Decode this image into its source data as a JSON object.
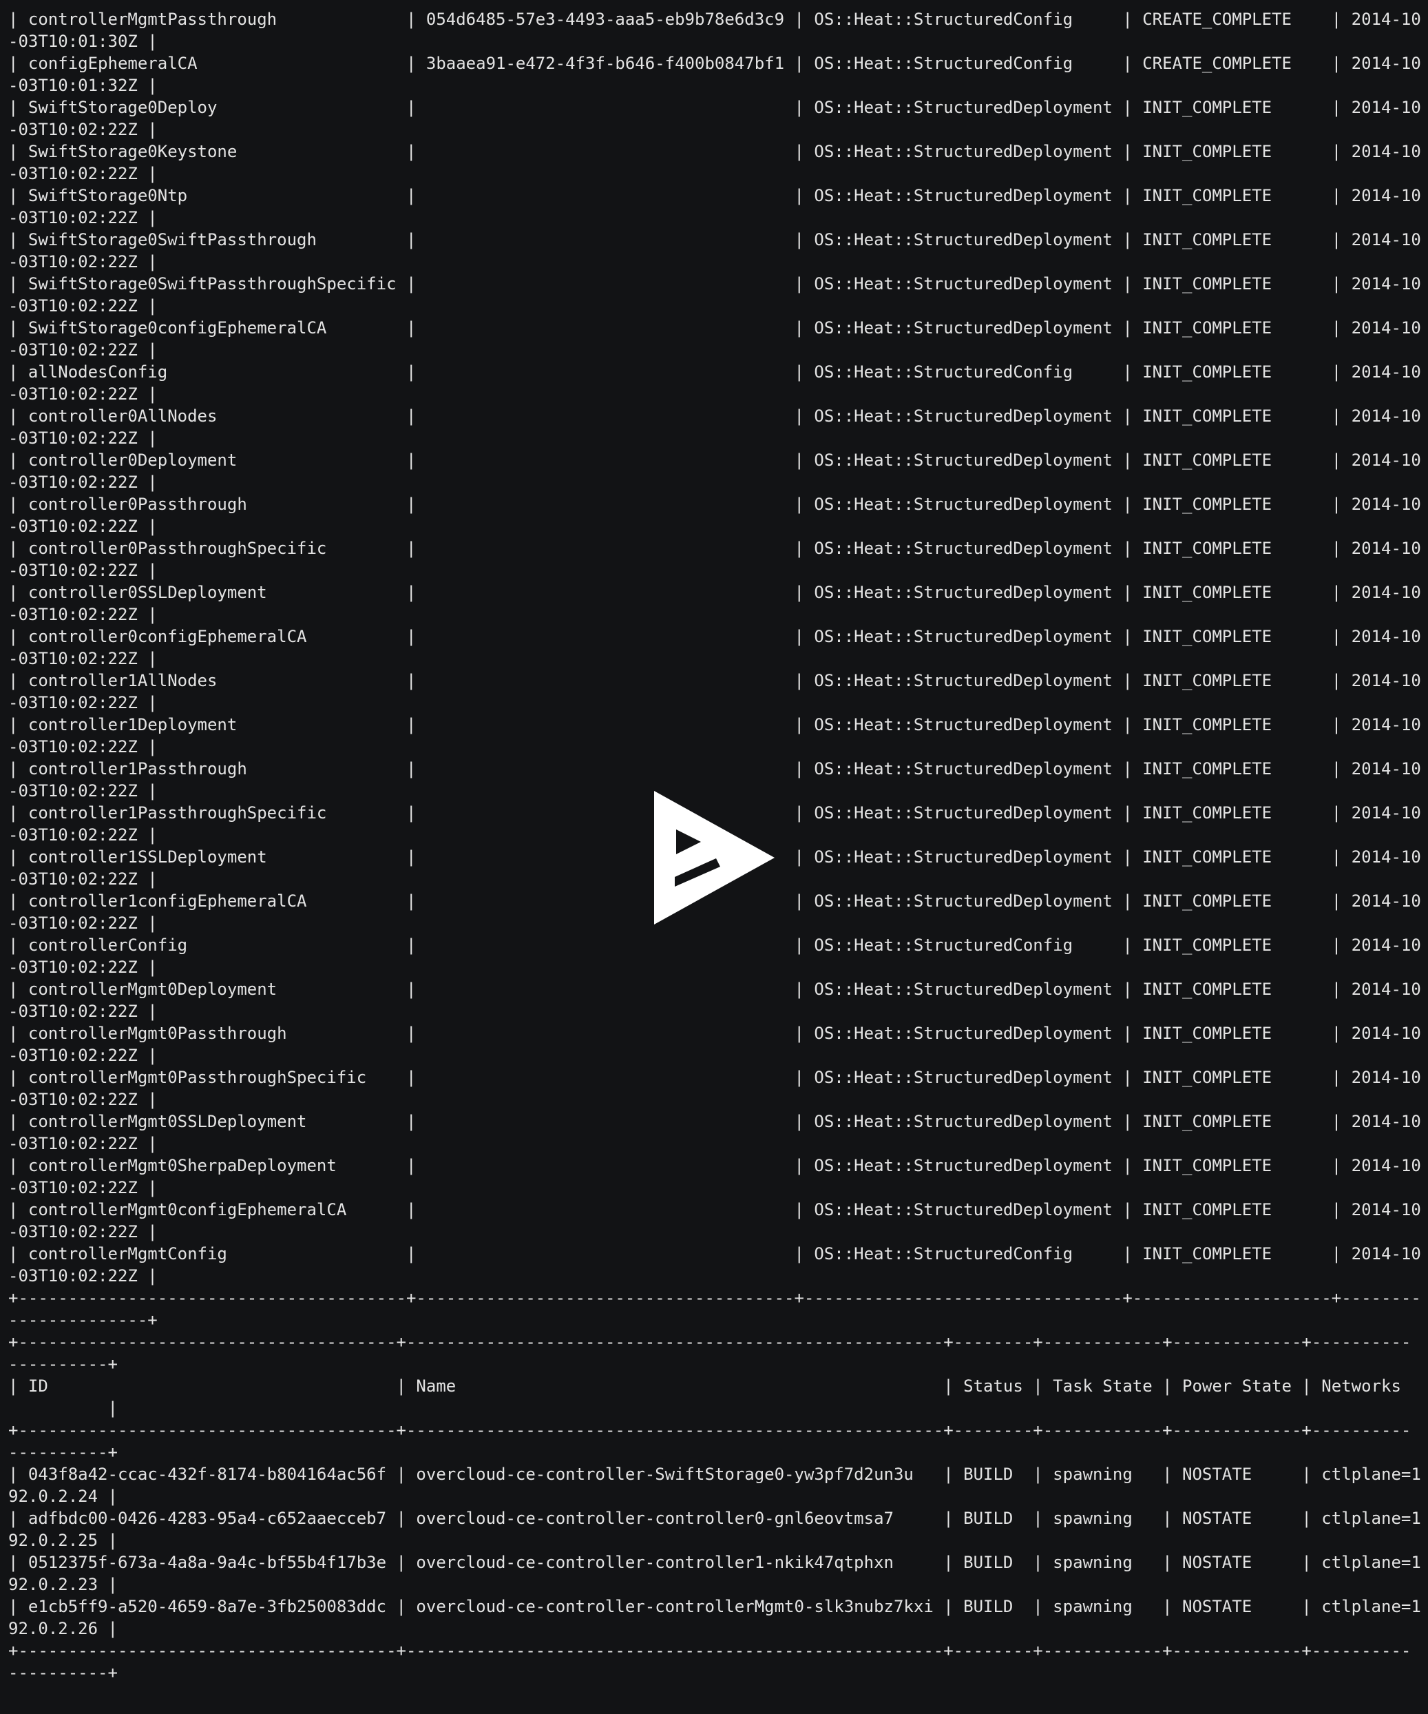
{
  "terminal": {
    "lines": [
      "| controllerMgmtPassthrough             | 054d6485-57e3-4493-aaa5-eb9b78e6d3c9 | OS::Heat::StructuredConfig     | CREATE_COMPLETE    | 2014-10",
      "-03T10:01:30Z |",
      "| configEphemeralCA                     | 3baaea91-e472-4f3f-b646-f400b0847bf1 | OS::Heat::StructuredConfig     | CREATE_COMPLETE    | 2014-10",
      "-03T10:01:32Z |",
      "| SwiftStorage0Deploy                   |                                      | OS::Heat::StructuredDeployment | INIT_COMPLETE      | 2014-10",
      "-03T10:02:22Z |",
      "| SwiftStorage0Keystone                 |                                      | OS::Heat::StructuredDeployment | INIT_COMPLETE      | 2014-10",
      "-03T10:02:22Z |",
      "| SwiftStorage0Ntp                      |                                      | OS::Heat::StructuredDeployment | INIT_COMPLETE      | 2014-10",
      "-03T10:02:22Z |",
      "| SwiftStorage0SwiftPassthrough         |                                      | OS::Heat::StructuredDeployment | INIT_COMPLETE      | 2014-10",
      "-03T10:02:22Z |",
      "| SwiftStorage0SwiftPassthroughSpecific |                                      | OS::Heat::StructuredDeployment | INIT_COMPLETE      | 2014-10",
      "-03T10:02:22Z |",
      "| SwiftStorage0configEphemeralCA        |                                      | OS::Heat::StructuredDeployment | INIT_COMPLETE      | 2014-10",
      "-03T10:02:22Z |",
      "| allNodesConfig                        |                                      | OS::Heat::StructuredConfig     | INIT_COMPLETE      | 2014-10",
      "-03T10:02:22Z |",
      "| controller0AllNodes                   |                                      | OS::Heat::StructuredDeployment | INIT_COMPLETE      | 2014-10",
      "-03T10:02:22Z |",
      "| controller0Deployment                 |                                      | OS::Heat::StructuredDeployment | INIT_COMPLETE      | 2014-10",
      "-03T10:02:22Z |",
      "| controller0Passthrough                |                                      | OS::Heat::StructuredDeployment | INIT_COMPLETE      | 2014-10",
      "-03T10:02:22Z |",
      "| controller0PassthroughSpecific        |                                      | OS::Heat::StructuredDeployment | INIT_COMPLETE      | 2014-10",
      "-03T10:02:22Z |",
      "| controller0SSLDeployment              |                                      | OS::Heat::StructuredDeployment | INIT_COMPLETE      | 2014-10",
      "-03T10:02:22Z |",
      "| controller0configEphemeralCA          |                                      | OS::Heat::StructuredDeployment | INIT_COMPLETE      | 2014-10",
      "-03T10:02:22Z |",
      "| controller1AllNodes                   |                                      | OS::Heat::StructuredDeployment | INIT_COMPLETE      | 2014-10",
      "-03T10:02:22Z |",
      "| controller1Deployment                 |                                      | OS::Heat::StructuredDeployment | INIT_COMPLETE      | 2014-10",
      "-03T10:02:22Z |",
      "| controller1Passthrough                |                                      | OS::Heat::StructuredDeployment | INIT_COMPLETE      | 2014-10",
      "-03T10:02:22Z |",
      "| controller1PassthroughSpecific        |                                      | OS::Heat::StructuredDeployment | INIT_COMPLETE      | 2014-10",
      "-03T10:02:22Z |",
      "| controller1SSLDeployment              |                                      | OS::Heat::StructuredDeployment | INIT_COMPLETE      | 2014-10",
      "-03T10:02:22Z |",
      "| controller1configEphemeralCA          |                                      | OS::Heat::StructuredDeployment | INIT_COMPLETE      | 2014-10",
      "-03T10:02:22Z |",
      "| controllerConfig                      |                                      | OS::Heat::StructuredConfig     | INIT_COMPLETE      | 2014-10",
      "-03T10:02:22Z |",
      "| controllerMgmt0Deployment             |                                      | OS::Heat::StructuredDeployment | INIT_COMPLETE      | 2014-10",
      "-03T10:02:22Z |",
      "| controllerMgmt0Passthrough            |                                      | OS::Heat::StructuredDeployment | INIT_COMPLETE      | 2014-10",
      "-03T10:02:22Z |",
      "| controllerMgmt0PassthroughSpecific    |                                      | OS::Heat::StructuredDeployment | INIT_COMPLETE      | 2014-10",
      "-03T10:02:22Z |",
      "| controllerMgmt0SSLDeployment          |                                      | OS::Heat::StructuredDeployment | INIT_COMPLETE      | 2014-10",
      "-03T10:02:22Z |",
      "| controllerMgmt0SherpaDeployment       |                                      | OS::Heat::StructuredDeployment | INIT_COMPLETE      | 2014-10",
      "-03T10:02:22Z |",
      "| controllerMgmt0configEphemeralCA      |                                      | OS::Heat::StructuredDeployment | INIT_COMPLETE      | 2014-10",
      "-03T10:02:22Z |",
      "| controllerMgmtConfig                  |                                      | OS::Heat::StructuredConfig     | INIT_COMPLETE      | 2014-10",
      "-03T10:02:22Z |",
      "+---------------------------------------+--------------------------------------+--------------------------------+--------------------+--------",
      "--------------+",
      "+--------------------------------------+------------------------------------------------------+--------+------------+-------------+----------",
      "----------+",
      "| ID                                   | Name                                                 | Status | Task State | Power State | Networks",
      "          |",
      "+--------------------------------------+------------------------------------------------------+--------+------------+-------------+----------",
      "----------+",
      "| 043f8a42-ccac-432f-8174-b804164ac56f | overcloud-ce-controller-SwiftStorage0-yw3pf7d2un3u   | BUILD  | spawning   | NOSTATE     | ctlplane=1",
      "92.0.2.24 |",
      "| adfbdc00-0426-4283-95a4-c652aaecceb7 | overcloud-ce-controller-controller0-gnl6eovtmsa7     | BUILD  | spawning   | NOSTATE     | ctlplane=1",
      "92.0.2.25 |",
      "| 0512375f-673a-4a8a-9a4c-bf55b4f17b3e | overcloud-ce-controller-controller1-nkik47qtphxn     | BUILD  | spawning   | NOSTATE     | ctlplane=1",
      "92.0.2.23 |",
      "| e1cb5ff9-a520-4659-8a7e-3fb250083ddc | overcloud-ce-controller-controllerMgmt0-slk3nubz7kxi | BUILD  | spawning   | NOSTATE     | ctlplane=1",
      "92.0.2.26 |",
      "+--------------------------------------+------------------------------------------------------+--------+------------+-------------+----------",
      "----------+"
    ]
  },
  "overlay": {
    "icon": "asciinema-play-icon"
  },
  "colors": {
    "background": "#121315",
    "foreground": "#e3e3e3",
    "icon": "#ffffff"
  }
}
